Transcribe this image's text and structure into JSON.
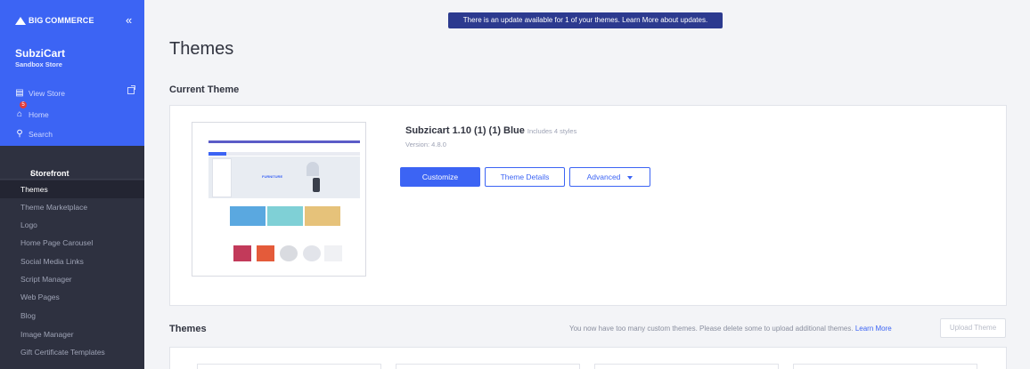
{
  "sidebar": {
    "brand": "COMMERCE",
    "brand_prefix": "BIG",
    "collapse": "«",
    "store_name": "SubziCart",
    "store_sub": "Sandbox Store",
    "view_store": "View Store",
    "home": "Home",
    "home_badge": "5",
    "search": "Search",
    "section": "Storefront",
    "items": [
      {
        "label": "Themes",
        "active": true
      },
      {
        "label": "Theme Marketplace"
      },
      {
        "label": "Logo"
      },
      {
        "label": "Home Page Carousel"
      },
      {
        "label": "Social Media Links"
      },
      {
        "label": "Script Manager"
      },
      {
        "label": "Web Pages"
      },
      {
        "label": "Blog"
      },
      {
        "label": "Image Manager"
      },
      {
        "label": "Gift Certificate Templates"
      }
    ]
  },
  "notice": "There is an update available for 1 of your themes. Learn More about updates.",
  "page_title": "Themes",
  "current_theme": {
    "heading": "Current Theme",
    "name": "Subzicart 1.10 (1) (1) Blue",
    "styles": "Includes 4 styles",
    "version": "Version: 4.8.0",
    "customize": "Customize",
    "details": "Theme Details",
    "advanced": "Advanced",
    "preview_text": "FURNITURE"
  },
  "themes": {
    "heading": "Themes",
    "message": "You now have too many custom themes. Please delete some to upload additional themes.",
    "learn_more": "Learn More",
    "upload": "Upload Theme"
  }
}
